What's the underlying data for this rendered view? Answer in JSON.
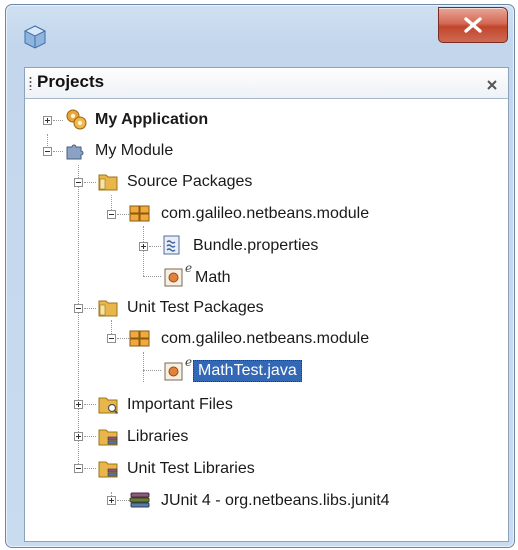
{
  "window": {
    "close_label": "X",
    "close_color": "#c1452d"
  },
  "panel": {
    "title": "Projects",
    "close_glyph": "✕"
  },
  "tree": {
    "my_application": "My Application",
    "my_module": "My Module",
    "source_packages": "Source Packages",
    "source_pkg": "com.galileo.netbeans.module",
    "bundle": "Bundle.properties",
    "math": "Math",
    "unit_test_packages": "Unit Test Packages",
    "test_pkg": "com.galileo.netbeans.module",
    "mathtest": "MathTest.java",
    "important_files": "Important Files",
    "libraries": "Libraries",
    "unit_test_libraries": "Unit Test Libraries",
    "junit": "JUnit 4 - org.netbeans.libs.junit4",
    "test_badge": "e"
  },
  "colors": {
    "selection": "#3268b6",
    "folder": "#e8b64a",
    "package": "#f0a93a"
  }
}
